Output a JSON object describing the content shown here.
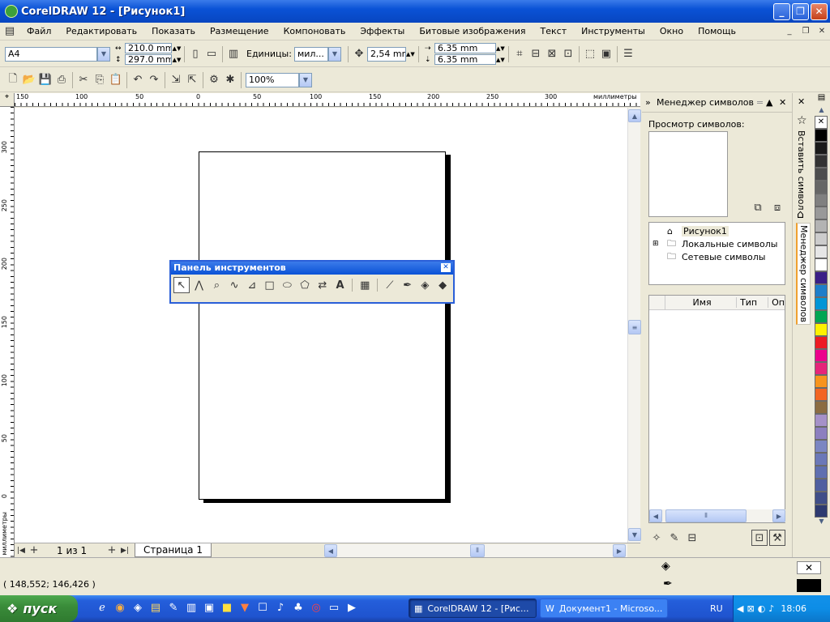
{
  "app": {
    "title": "CorelDRAW 12 - [Рисунок1]"
  },
  "menu": {
    "items": [
      "Файл",
      "Редактировать",
      "Показать",
      "Размещение",
      "Компоновать",
      "Эффекты",
      "Битовые изображения",
      "Текст",
      "Инструменты",
      "Окно",
      "Помощь"
    ]
  },
  "property_bar": {
    "paper_size": "A4",
    "width": "210.0 mm",
    "height": "297.0 mm",
    "units_label": "Единицы:",
    "units_value": "мил...",
    "nudge": "2,54 mm",
    "dup_x": "6.35 mm",
    "dup_y": "6.35 mm"
  },
  "standard_bar": {
    "zoom": "100%"
  },
  "ruler": {
    "unit_label": "миллиметры",
    "h_ticks": [
      "150",
      "100",
      "50",
      "0",
      "50",
      "100",
      "150",
      "200",
      "250",
      "300"
    ],
    "v_ticks": [
      "300",
      "250",
      "200",
      "150",
      "100",
      "50",
      "0"
    ]
  },
  "page_nav": {
    "counter": "1 из 1",
    "tab": "Страница 1"
  },
  "floating_toolbox": {
    "title": "Панель инструментов"
  },
  "symbol_manager": {
    "title": "Менеджер символов",
    "preview_label": "Просмотр символов:",
    "tree": [
      "Рисунок1",
      "Локальные символы",
      "Сетевые символы"
    ],
    "columns": [
      "Имя",
      "Тип",
      "Оп"
    ]
  },
  "side_tabs": {
    "insert_symbol": "Вставить символ",
    "symbol_manager": "Менеджер символов"
  },
  "palette": {
    "colors": [
      "#ffffff",
      "#000000",
      "#1a1a1a",
      "#333333",
      "#4d4d4d",
      "#666666",
      "#808080",
      "#999999",
      "#b3b3b3",
      "#cccccc",
      "#e6e6e6",
      "#ffffff",
      "#3a1f86",
      "#1d7fc9",
      "#0096d6",
      "#00a651",
      "#fff200",
      "#ed1c24",
      "#ec008c",
      "#e5257a",
      "#f7941d",
      "#f26522",
      "#8b6c42",
      "#a591c8",
      "#8c7fbf",
      "#7b86c2",
      "#6b78b8",
      "#5f6fb0",
      "#4f5fa0",
      "#404e88",
      "#2e3a70"
    ]
  },
  "status": {
    "coords": "( 148,552; 146,426 )"
  },
  "taskbar": {
    "start": "пуск",
    "buttons": [
      "CorelDRAW 12 - [Рис...",
      "Документ1 - Microso..."
    ],
    "lang": "RU",
    "time": "18:06"
  }
}
